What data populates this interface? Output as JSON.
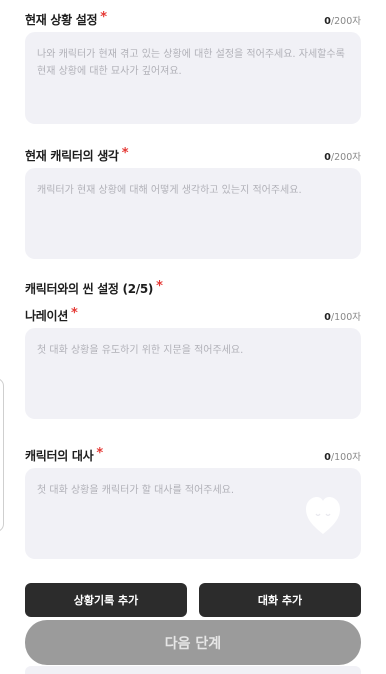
{
  "fields": [
    {
      "label": "현재 상황 설정",
      "required_mark": "*",
      "count_current": "0",
      "count_max": "/200자",
      "placeholder": "나와 캐릭터가 현재 겪고 있는 상황에 대한 설정을 적어주세요. 자세할수록 현재 상황에 대한 묘사가 깊어져요."
    },
    {
      "label": "현재 캐릭터의 생각",
      "required_mark": "*",
      "count_current": "0",
      "count_max": "/200자",
      "placeholder": "캐릭터가 현재 상황에 대해 어떻게 생각하고 있는지 적어주세요."
    },
    {
      "label": "나레이션",
      "required_mark": "*",
      "count_current": "0",
      "count_max": "/100자",
      "placeholder": "첫 대화 상황을 유도하기 위한 지문을 적어주세요."
    },
    {
      "label": "캐릭터의 대사",
      "required_mark": "*",
      "count_current": "0",
      "count_max": "/100자",
      "placeholder": "첫 대화 상황을 캐릭터가 할 대사를 적어주세요."
    }
  ],
  "scene_group": {
    "title": "캐릭터와의 씬 설정 (2/5)",
    "required_mark": "*"
  },
  "buttons": {
    "add_situation": "상황기록 추가",
    "add_dialogue": "대화 추가",
    "next": "다음 단계"
  }
}
